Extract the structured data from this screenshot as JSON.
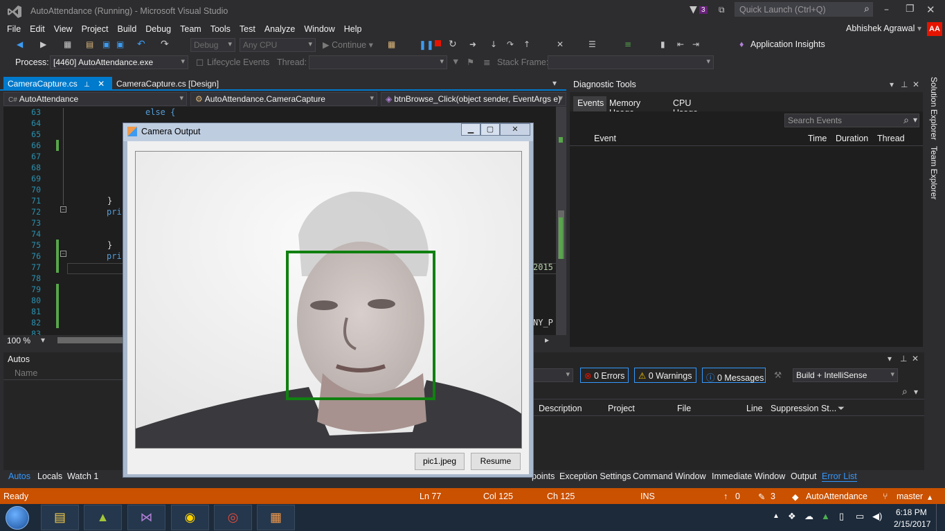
{
  "window": {
    "title": "AutoAttendance (Running) - Microsoft Visual Studio",
    "notif_count": "3",
    "quick_launch": "Quick Launch (Ctrl+Q)"
  },
  "menu": [
    "File",
    "Edit",
    "View",
    "Project",
    "Build",
    "Debug",
    "Team",
    "Tools",
    "Test",
    "Analyze",
    "Window",
    "Help"
  ],
  "user": {
    "name": "Abhishek Agrawal",
    "initials": "AA"
  },
  "toolbar": {
    "config": "Debug",
    "platform": "Any CPU",
    "continue": "Continue",
    "app_insights": "Application Insights"
  },
  "toolbar2": {
    "process_label": "Process:",
    "process": "[4460] AutoAttendance.exe",
    "lifecycle": "Lifecycle Events",
    "thread_label": "Thread:",
    "stackframe_label": "Stack Frame:"
  },
  "tabs": [
    {
      "label": "CameraCapture.cs",
      "active": true
    },
    {
      "label": "CameraCapture.cs [Design]",
      "active": false
    }
  ],
  "nav": {
    "project": "AutoAttendance",
    "class": "AutoAttendance.CameraCapture",
    "member": "btnBrowse_Click(object sender, EventArgs e)"
  },
  "editor": {
    "lines": [
      "63",
      "64",
      "65",
      "66",
      "67",
      "68",
      "69",
      "70",
      "71",
      "72",
      "73",
      "74",
      "75",
      "76",
      "77",
      "78",
      "79",
      "80",
      "81",
      "82",
      "83"
    ],
    "code_else": "else {",
    "code_brace": "}",
    "code_pri": "pri",
    "code_2015": "2015",
    "code_nyp": "NY_P",
    "zoom": "100 %"
  },
  "diagnostic": {
    "title": "Diagnostic Tools",
    "tabs": [
      "Events",
      "Memory Usage",
      "CPU Usage"
    ],
    "search": "Search Events",
    "columns": [
      "Event",
      "Time",
      "Duration",
      "Thread"
    ]
  },
  "side_tabs": [
    "Solution Explorer",
    "Team Explorer"
  ],
  "autos": {
    "title": "Autos",
    "column": "Name"
  },
  "errors": {
    "errors": "0 Errors",
    "warnings": "0 Warnings",
    "messages": "0 Messages",
    "filter": "Build + IntelliSense",
    "columns": [
      "Description",
      "Project",
      "File",
      "Line",
      "Suppression St..."
    ]
  },
  "bottom_tabs_left": [
    "Autos",
    "Locals",
    "Watch 1"
  ],
  "bottom_tabs_right": [
    "points",
    "Exception Settings",
    "Command Window",
    "Immediate Window",
    "Output",
    "Error List"
  ],
  "status": {
    "ready": "Ready",
    "ln": "Ln 77",
    "col": "Col 125",
    "ch": "Ch 125",
    "ins": "INS",
    "up": "0",
    "pencil": "3",
    "project": "AutoAttendance",
    "branch": "master"
  },
  "clock": {
    "time": "6:18 PM",
    "date": "2/15/2017"
  },
  "dialog": {
    "title": "Camera Output",
    "btn1": "pic1.jpeg",
    "btn2": "Resume"
  },
  "colors": {
    "accent": "#007acc",
    "status_bar": "#ca5100",
    "face_box": "#108010"
  }
}
